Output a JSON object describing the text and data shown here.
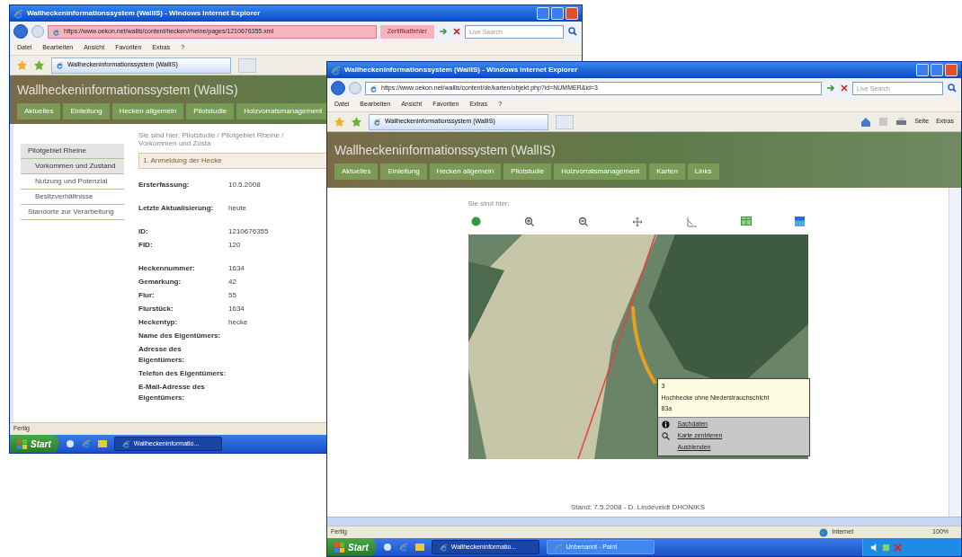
{
  "back_window": {
    "title": "Wallheckeninformationssystem (WallIS) - Windows Internet Explorer",
    "address_url": "https://www.oekon.net/wallis/content/hecken/rheine/pages/1210676355.xml",
    "certificate_error": "Zertifikatfehler",
    "search_placeholder": "Live Search",
    "menu": [
      "Datei",
      "Bearbeiten",
      "Ansicht",
      "Favoriten",
      "Extras",
      "?"
    ],
    "tab_label": "Wallheckeninformationssystem (WallIS)",
    "site_title": "Wallheckeninformationssystem (WallIS)",
    "nav": [
      {
        "label": "Aktuelles"
      },
      {
        "label": "Einleitung"
      },
      {
        "label": "Hecken allgemein"
      },
      {
        "label": "Pilotstudie"
      },
      {
        "label": "Holzvorratsmanagement"
      }
    ],
    "breadcrumb": "Sie sind hier: Pilotstudie / Pilotgebiet Rheine / Vorkommen und Zusta",
    "sidebar": [
      {
        "label": "Pilotgebiet Rheine",
        "selected": true,
        "children": [
          {
            "label": "Vorkommen und Zustand",
            "selected": true
          },
          {
            "label": "Nutzung und Potenzial",
            "selected": false
          },
          {
            "label": "Besitzverhältnisse",
            "selected": false
          }
        ]
      },
      {
        "label": "Standorte zur Verarbeitung",
        "selected": false
      }
    ],
    "section_heading": "1. Anmeldung der Hecke",
    "field_groups": [
      [
        {
          "label": "Ersterfassung:",
          "value": "10.5.2008"
        }
      ],
      [
        {
          "label": "Letzte Aktualisierung:",
          "value": "heute"
        }
      ],
      [
        {
          "label": "ID:",
          "value": "1210676355"
        },
        {
          "label": "FID:",
          "value": "120"
        }
      ],
      [
        {
          "label": "Heckennummer:",
          "value": "1634"
        },
        {
          "label": "Gemarkung:",
          "value": "42"
        },
        {
          "label": "Flur:",
          "value": "55"
        },
        {
          "label": "Flurstück:",
          "value": "1634"
        },
        {
          "label": "Heckentyp:",
          "value": "hecke"
        },
        {
          "label": "Name des Eigentümers:"
        },
        {
          "label": "Adresse des Eigentümers:"
        },
        {
          "label": "Telefon des Eigentümers:"
        },
        {
          "label": "E-Mail-Adresse des Eigentümers:"
        }
      ]
    ],
    "status": "Fertig",
    "start_label": "Start",
    "tasks": [
      {
        "label": "Wallheckeninformatio...",
        "selected": true
      }
    ]
  },
  "front_window": {
    "title": "Wallheckeninformationssystem (WallIS) - Windows Internet Explorer",
    "address_url": "https://www.oekon.net/wallis/content/de/karten/objekt.php?id=NUMMER&id=3",
    "search_placeholder": "Live Search",
    "menu": [
      "Datei",
      "Bearbeiten",
      "Ansicht",
      "Favoriten",
      "Extras",
      "?"
    ],
    "tab_label": "Wallheckeninformationssystem (WallIS)",
    "toolbar_buttons": [
      "Seite",
      "Extras"
    ],
    "site_title": "Wallheckeninformationssystem (WallIS)",
    "nav": [
      {
        "label": "Aktuelles"
      },
      {
        "label": "Einleitung"
      },
      {
        "label": "Hecken allgemein"
      },
      {
        "label": "Pilotstudie"
      },
      {
        "label": "Holzvorratsmanagement"
      },
      {
        "label": "Karten"
      },
      {
        "label": "Links"
      }
    ],
    "breadcrumb": "Sie sind hier:",
    "popup": {
      "lines": [
        "3",
        "Hochhecke ohne Niederstrauchschicht",
        "83a"
      ],
      "actions": [
        {
          "label": "Sachdaten",
          "kind": "info"
        },
        {
          "label": "Karte zentrieren",
          "kind": "zoom"
        },
        {
          "label": "Ausblenden",
          "kind": "plain"
        }
      ]
    },
    "footer": "Stand: 7.5.2008 - D. Lindeveldt DHONIKS",
    "status": "Fertig",
    "zone": "Internet",
    "zoom": "100%",
    "start_label": "Start",
    "tasks": [
      {
        "label": "Wallheckeninformatio...",
        "selected": true
      },
      {
        "label": "Unbenannt - Paint",
        "selected": false
      }
    ]
  }
}
